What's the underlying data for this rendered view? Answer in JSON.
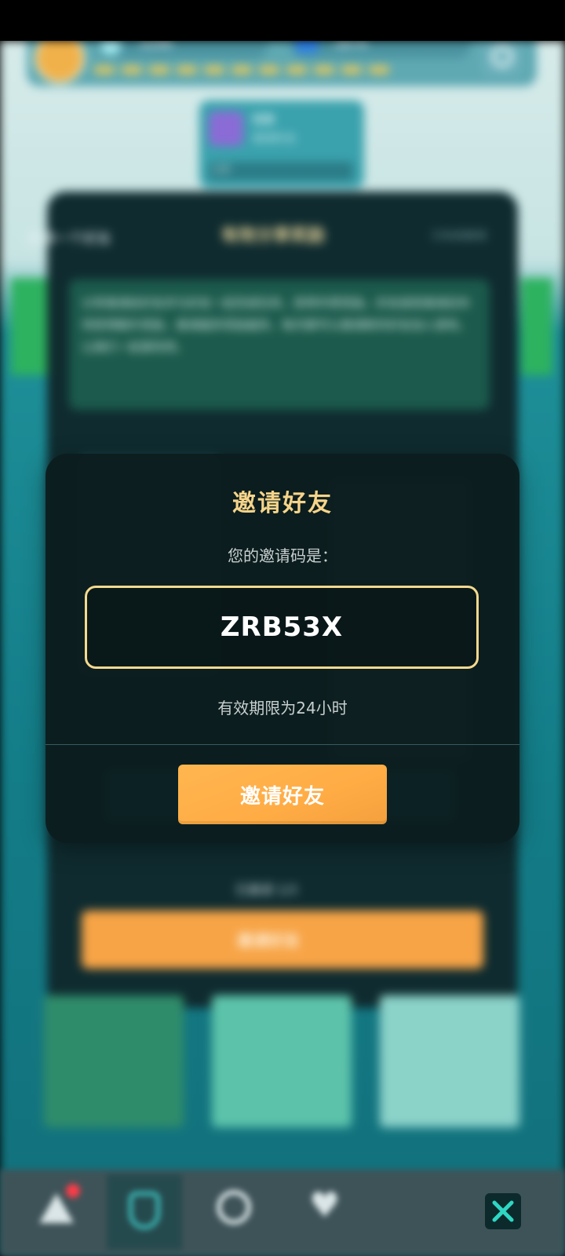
{
  "background": {
    "hud": {
      "gem_value": "3246",
      "energy_value": "1874"
    },
    "quest": {
      "title": "任务",
      "subtitle": "邀请好友",
      "bar_text": "1/3"
    },
    "panel": {
      "title": "有效分享奖励",
      "left_text": "邀请一个好友",
      "right_text": "已完成邀请",
      "description": "分享邀请给好友并与好友一起完成任务，获得丰厚奖励。好友接受邀请后你将获得额外奖励，邀请越多奖励越多。每天都可以邀请新的好友加入游戏，让我们一起冒险吧。",
      "mid_text": "已邀请 1/3",
      "orange_button": "邀请好友"
    }
  },
  "modal": {
    "title": "邀请好友",
    "code_label": "您的邀请码是：",
    "invite_code": "ZRB53X",
    "validity": "有效期限为24小时",
    "button_label": "邀请好友"
  },
  "colors": {
    "modal_title": "#f6d48a",
    "code_border": "#f4d98e",
    "button_orange": "#ffac45",
    "close_x": "#2fd6c4"
  },
  "icons": {
    "close": "close-x-icon",
    "nav": [
      "warning-icon",
      "shield-icon",
      "compass-icon",
      "heart-icon"
    ]
  }
}
